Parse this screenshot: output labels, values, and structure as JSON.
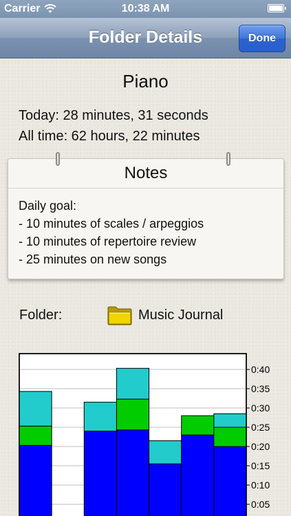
{
  "status_bar": {
    "carrier": "Carrier",
    "time": "10:38 AM"
  },
  "nav": {
    "title": "Folder Details",
    "done_label": "Done"
  },
  "folder_name": "Piano",
  "stats": {
    "today": "Today: 28 minutes, 31 seconds",
    "all_time": "All time: 62 hours, 22 minutes"
  },
  "notes": {
    "title": "Notes",
    "lines": [
      "Daily goal:",
      "- 10 minutes of scales / arpeggios",
      "- 10 minutes of repertoire review",
      "- 25 minutes on new songs"
    ]
  },
  "folder_row": {
    "label": "Folder:",
    "value": "Music Journal"
  },
  "colors": {
    "nav": "#7b91af",
    "done": "#3f74d8",
    "cyan": "#22cccc",
    "green": "#00cc00",
    "blue": "#0000ff"
  },
  "chart_data": {
    "type": "bar",
    "stacked": true,
    "categories": [
      "",
      "",
      "",
      "",
      "",
      "",
      ""
    ],
    "series": [
      {
        "color": "#0000ff",
        "values": [
          20.3,
          0,
          24.0,
          24.3,
          15.5,
          23.0,
          20.0
        ]
      },
      {
        "color": "#00cc00",
        "values": [
          5.0,
          0,
          0,
          8.0,
          0,
          5.0,
          5.0
        ]
      },
      {
        "color": "#22cccc",
        "values": [
          9.0,
          0,
          7.5,
          8.0,
          6.0,
          0,
          3.5
        ]
      }
    ],
    "ylim": [
      0,
      40
    ],
    "yticks": [
      "0:05",
      "0:10",
      "0:15",
      "0:20",
      "0:25",
      "0:30",
      "0:35",
      "0:40"
    ],
    "grid": true
  }
}
